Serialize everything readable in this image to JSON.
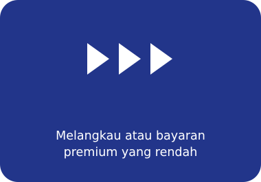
{
  "card": {
    "background_color": "#22358a",
    "icon": "triple-play-arrows-icon",
    "icon_color": "#ffffff",
    "caption_lines": [
      "Melangkau atau bayaran",
      "premium yang rendah"
    ]
  }
}
